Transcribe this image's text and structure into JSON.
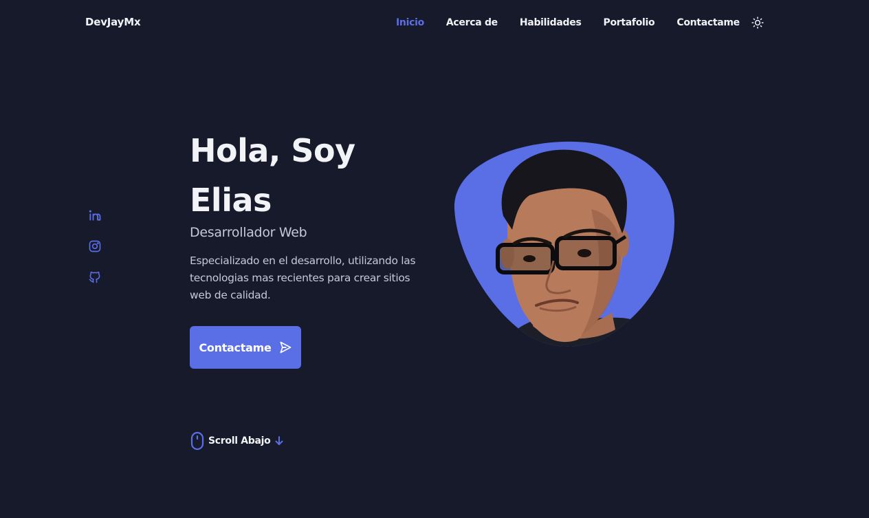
{
  "header": {
    "logo": "DevJayMx",
    "nav": [
      {
        "label": "Inicio",
        "active": true
      },
      {
        "label": "Acerca de",
        "active": false
      },
      {
        "label": "Habilidades",
        "active": false
      },
      {
        "label": "Portafolio",
        "active": false
      },
      {
        "label": "Contactame",
        "active": false
      }
    ],
    "theme_icon": "sun-icon"
  },
  "social": [
    "linkedin-icon",
    "instagram-icon",
    "github-icon"
  ],
  "hero": {
    "title_line1": "Hola, Soy",
    "title_line2": "Elias",
    "subtitle": "Desarrollador Web",
    "description": "Especializado en el desarrollo, utilizando las tecnologias mas recientes para crear sitios web de calidad.",
    "cta_label": "Contactame",
    "cta_icon": "send-icon"
  },
  "scroll": {
    "label": "Scroll Abajo",
    "icon": "mouse-icon",
    "arrow_icon": "arrow-down-icon"
  },
  "colors": {
    "background": "#171a2b",
    "accent": "#5a6ee6",
    "text": "#f2f3f7",
    "muted": "#c5c8d6"
  }
}
